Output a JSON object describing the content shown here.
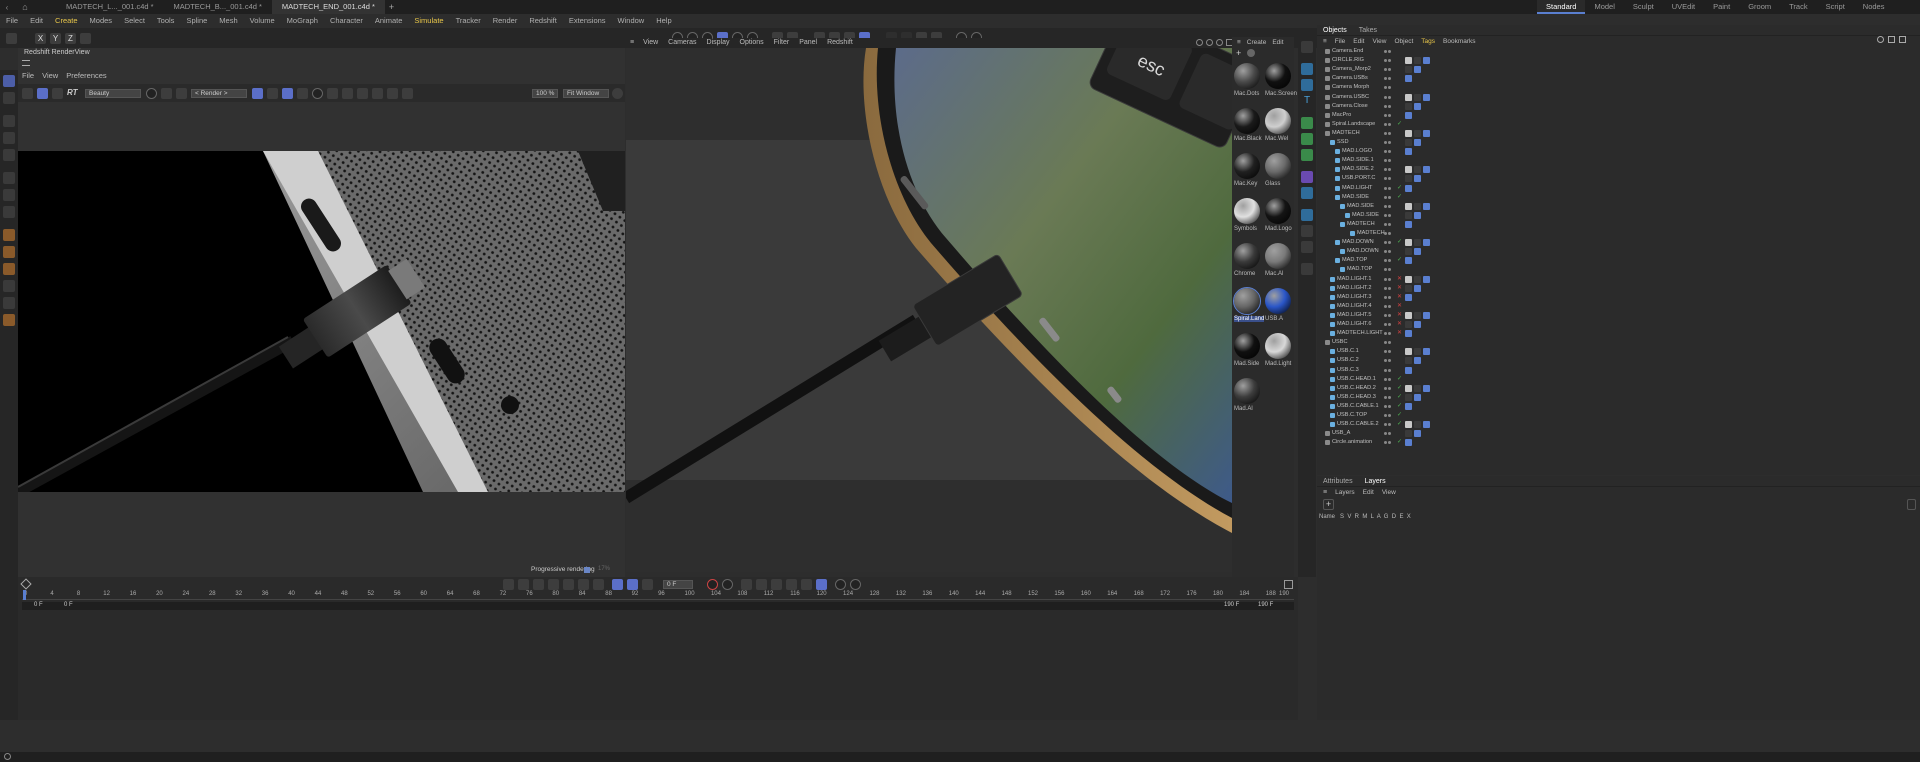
{
  "titlebar": {
    "docs": [
      "MADTECH_L..._001.c4d *",
      "MADTECH_B..._001.c4d *",
      "MADTECH_END_001.c4d *"
    ],
    "active_doc": 2,
    "layouts": [
      "Standard",
      "Model",
      "Sculpt",
      "UVEdit",
      "Paint",
      "Groom",
      "Track",
      "Script",
      "Nodes"
    ],
    "active_layout": 0
  },
  "menubar": [
    "File",
    "Edit",
    "Create",
    "Modes",
    "Select",
    "Tools",
    "Spline",
    "Mesh",
    "Volume",
    "MoGraph",
    "Character",
    "Animate",
    "Simulate",
    "Tracker",
    "Render",
    "Redshift",
    "Extensions",
    "Window",
    "Help"
  ],
  "coord_toolbar": {
    "x": "X",
    "y": "Y",
    "z": "Z"
  },
  "renderview": {
    "title": "Redshift RenderView",
    "menu": [
      "File",
      "View",
      "Preferences"
    ],
    "aov": "Beauty",
    "render_target": "< Render >",
    "zoom": "100 %",
    "fit": "Fit Window",
    "progressive": "Progressive rendering",
    "progress_pct": "17%"
  },
  "viewport": {
    "menu": [
      "View",
      "Cameras",
      "Display",
      "Options",
      "Filter",
      "Panel",
      "Redshift"
    ],
    "key_label": "esc"
  },
  "materials": {
    "menu": [
      "Create",
      "Edit"
    ],
    "items": [
      {
        "name": "Mac.Dots",
        "color": "#4a4a4a"
      },
      {
        "name": "Mac.Screen",
        "color": "#101010"
      },
      {
        "name": "Mac.Black",
        "color": "#1a1a1a"
      },
      {
        "name": "Mac.Wel",
        "color": "#cfcfcf"
      },
      {
        "name": "Mac.Key",
        "color": "#202020"
      },
      {
        "name": "Glass",
        "color": "#6a6a6a"
      },
      {
        "name": "Symbols",
        "color": "#e0e0e0"
      },
      {
        "name": "Mad.Logo",
        "color": "#141414"
      },
      {
        "name": "Chrome",
        "color": "#3a3a3a"
      },
      {
        "name": "Mac.Al",
        "color": "#7a7a7a"
      },
      {
        "name": "Spiral.Land",
        "color": "#666"
      },
      {
        "name": "USB.A",
        "color": "#2a56c8"
      },
      {
        "name": "Mad.Side",
        "color": "#101010"
      },
      {
        "name": "Mad.Light",
        "color": "#d8d8d8"
      },
      {
        "name": "Mad.Al",
        "color": "#3d3d3d"
      }
    ],
    "selected": "Spiral.Land"
  },
  "objects": {
    "tabs": [
      "Objects",
      "Takes"
    ],
    "menu": [
      "File",
      "Edit",
      "View",
      "Object",
      "Tags",
      "Bookmarks"
    ],
    "rows": [
      {
        "name": "Camera.End",
        "indent": 0,
        "mark": ""
      },
      {
        "name": "CIRCLE.RIG",
        "indent": 0,
        "mark": ""
      },
      {
        "name": "Camera_Morp2",
        "indent": 0,
        "mark": ""
      },
      {
        "name": "Camera.USBs",
        "indent": 0,
        "mark": ""
      },
      {
        "name": "Camera Morph",
        "indent": 0,
        "mark": ""
      },
      {
        "name": "Camera.USBC",
        "indent": 0,
        "mark": ""
      },
      {
        "name": "Camera.Close",
        "indent": 0,
        "mark": ""
      },
      {
        "name": "MacPro",
        "indent": 0,
        "mark": ""
      },
      {
        "name": "Spiral.Landscape",
        "indent": 0,
        "mark": "check"
      },
      {
        "name": "MADTECH",
        "indent": 0,
        "mark": ""
      },
      {
        "name": "SSD",
        "indent": 1,
        "mark": ""
      },
      {
        "name": "MAD.LOGO",
        "indent": 2,
        "mark": ""
      },
      {
        "name": "MAD.SIDE.1",
        "indent": 2,
        "mark": ""
      },
      {
        "name": "MAD.SIDE.2",
        "indent": 2,
        "mark": ""
      },
      {
        "name": "USB.PORT.C",
        "indent": 2,
        "mark": ""
      },
      {
        "name": "MAD.LIGHT",
        "indent": 2,
        "mark": "check"
      },
      {
        "name": "MAD.SIDE",
        "indent": 2,
        "mark": "check"
      },
      {
        "name": "MAD.SIDE",
        "indent": 3,
        "mark": ""
      },
      {
        "name": "MAD.SIDE",
        "indent": 4,
        "mark": ""
      },
      {
        "name": "MADTECH",
        "indent": 3,
        "mark": ""
      },
      {
        "name": "MADTECH",
        "indent": 5,
        "mark": ""
      },
      {
        "name": "MAD.DOWN",
        "indent": 2,
        "mark": "check"
      },
      {
        "name": "MAD.DOWN",
        "indent": 3,
        "mark": ""
      },
      {
        "name": "MAD.TOP",
        "indent": 2,
        "mark": "check"
      },
      {
        "name": "MAD.TOP",
        "indent": 3,
        "mark": ""
      },
      {
        "name": "MAD.LIGHT.1",
        "indent": 1,
        "mark": "cross"
      },
      {
        "name": "MAD.LIGHT.2",
        "indent": 1,
        "mark": "cross"
      },
      {
        "name": "MAD.LIGHT.3",
        "indent": 1,
        "mark": "cross"
      },
      {
        "name": "MAD.LIGHT.4",
        "indent": 1,
        "mark": "cross"
      },
      {
        "name": "MAD.LIGHT.5",
        "indent": 1,
        "mark": "cross"
      },
      {
        "name": "MAD.LIGHT.6",
        "indent": 1,
        "mark": "cross"
      },
      {
        "name": "MADTECH.LIGHT",
        "indent": 1,
        "mark": "cross"
      },
      {
        "name": "USBC",
        "indent": 0,
        "mark": ""
      },
      {
        "name": "USB.C.1",
        "indent": 1,
        "mark": ""
      },
      {
        "name": "USB.C.2",
        "indent": 1,
        "mark": ""
      },
      {
        "name": "USB.C.3",
        "indent": 1,
        "mark": ""
      },
      {
        "name": "USB.C.HEAD.1",
        "indent": 1,
        "mark": "check"
      },
      {
        "name": "USB.C.HEAD.2",
        "indent": 1,
        "mark": "check"
      },
      {
        "name": "USB.C.HEAD.3",
        "indent": 1,
        "mark": "check"
      },
      {
        "name": "USB.C.CABLE.1",
        "indent": 1,
        "mark": "check"
      },
      {
        "name": "USB.C.TOP",
        "indent": 1,
        "mark": "check"
      },
      {
        "name": "USB.C.CABLE.2",
        "indent": 1,
        "mark": "check"
      },
      {
        "name": "USB_A",
        "indent": 0,
        "mark": ""
      },
      {
        "name": "Circle.animation",
        "indent": 0,
        "mark": "check"
      }
    ]
  },
  "attributes": {
    "tabs": [
      "Attributes",
      "Layers"
    ],
    "menu": [
      "Layers",
      "Edit",
      "View"
    ],
    "columns": "Name   S  V  R  M  L  A  G  D  E  X"
  },
  "timeline": {
    "ticks": [
      "0",
      "4",
      "8",
      "12",
      "16",
      "20",
      "24",
      "28",
      "32",
      "36",
      "40",
      "44",
      "48",
      "52",
      "56",
      "60",
      "64",
      "68",
      "72",
      "76",
      "80",
      "84",
      "88",
      "92",
      "96",
      "100",
      "104",
      "108",
      "112",
      "116",
      "120",
      "124",
      "128",
      "132",
      "136",
      "140",
      "144",
      "148",
      "152",
      "156",
      "160",
      "164",
      "168",
      "172",
      "176",
      "180",
      "184",
      "188",
      "190"
    ],
    "start": "0 F",
    "start2": "0 F",
    "current": "0 F",
    "end": "190 F",
    "end2": "190 F"
  }
}
